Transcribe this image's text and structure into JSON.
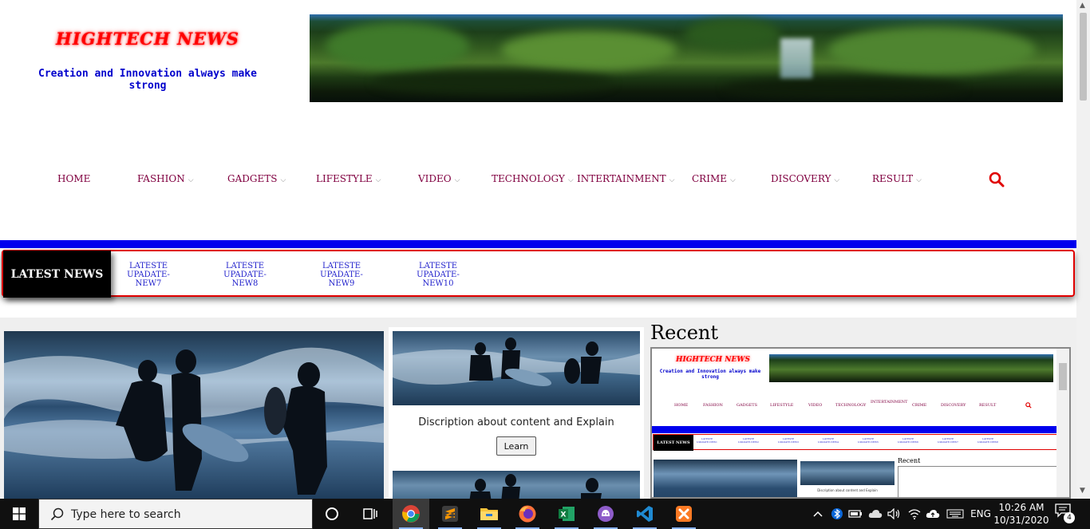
{
  "site": {
    "title": "HIGHTECH NEWS",
    "tagline": "Creation and Innovation always make strong"
  },
  "nav": {
    "items": [
      {
        "label": "HOME",
        "dropdown": false
      },
      {
        "label": "FASHION",
        "dropdown": true
      },
      {
        "label": "GADGETS",
        "dropdown": true
      },
      {
        "label": "LIFESTYLE",
        "dropdown": true
      },
      {
        "label": "VIDEO",
        "dropdown": true
      },
      {
        "label": "TECHNOLOGY",
        "dropdown": true
      },
      {
        "label": "INTERTAINMENT",
        "dropdown": true
      },
      {
        "label": "CRIME",
        "dropdown": true
      },
      {
        "label": "DISCOVERY",
        "dropdown": true
      },
      {
        "label": "RESULT",
        "dropdown": true
      }
    ],
    "chevron": "⌵",
    "search_icon": "search-icon"
  },
  "latest": {
    "label": "LATEST NEWS",
    "items": [
      "LATESTE UPADATE-NEW7",
      "LATESTE UPADATE-NEW8",
      "LATESTE UPADATE-NEW9",
      "LATESTE UPADATE-NEW10"
    ]
  },
  "content": {
    "card_description": "Discription about content and Explain",
    "learn_button": "Learn",
    "recent_title": "Recent"
  },
  "preview": {
    "title": "HIGHTECH NEWS",
    "tagline": "Creation and Innovation always make strong",
    "nav": [
      "HOME",
      "FASHION",
      "GADGETS",
      "LIFESTYLE",
      "VIDEO",
      "TECHNOLOGY",
      "INTERTAINMENT",
      "CRIME",
      "DISCOVERY",
      "RESULT"
    ],
    "latest_label": "LATEST NEWS",
    "ticker": [
      "LATESTE UPADATE-NEW1",
      "LATESTE UPADATE-NEW2",
      "LATESTE UPADATE-NEW3",
      "LATESTE UPADATE-NEW4",
      "LATESTE UPADATE-NEW5",
      "LATESTE UPADATE-NEW6",
      "LATESTE UPADATE-NEW7",
      "LATESTE UPADATE-NEW8"
    ],
    "card_description": "Discription about content and Explain",
    "recent": "Recent"
  },
  "taskbar": {
    "search_placeholder": "Type here to search",
    "apps": [
      "cortana-icon",
      "task-view-icon",
      "chrome-icon",
      "sublime-text-icon",
      "file-explorer-icon",
      "firefox-icon",
      "excel-icon",
      "github-desktop-icon",
      "vscode-icon",
      "xampp-icon"
    ],
    "language": "ENG",
    "time": "10:26 AM",
    "date": "10/31/2020",
    "notification_count": "4"
  },
  "colors": {
    "title_red": "#ff0000",
    "tagline_blue": "#0000cc",
    "nav_text": "#800040",
    "accent_blue": "#0000ee",
    "ticker_border": "#e00000"
  }
}
